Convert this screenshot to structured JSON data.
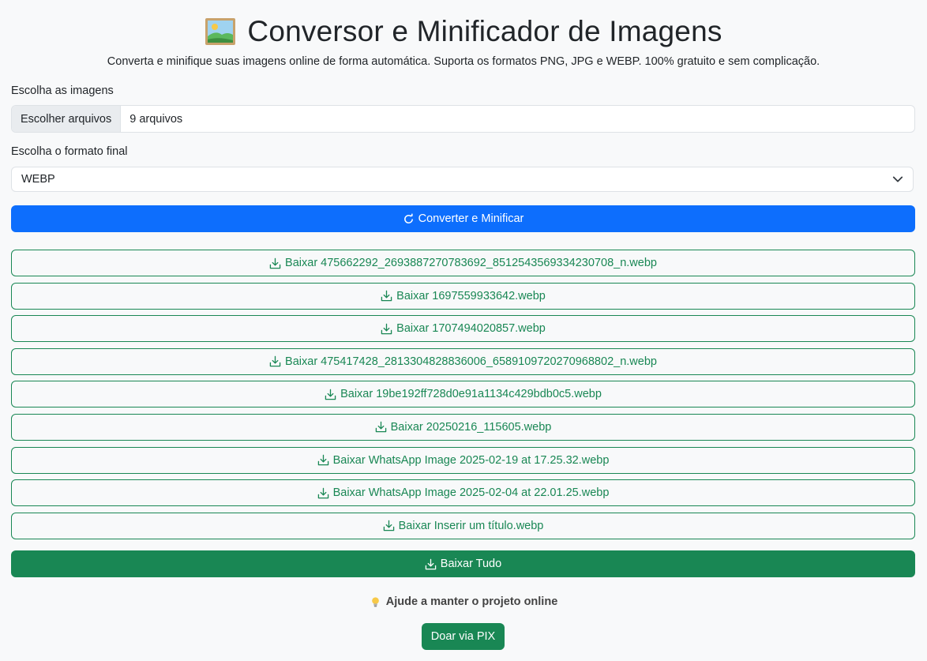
{
  "header": {
    "title": "Conversor e Minificador de Imagens",
    "subtitle": "Converta e minifique suas imagens online de forma automática. Suporta os formatos PNG, JPG e WEBP. 100% gratuito e sem complicação."
  },
  "file_input": {
    "label": "Escolha as imagens",
    "button_label": "Escolher arquivos",
    "value": "9 arquivos"
  },
  "format_select": {
    "label": "Escolha o formato final",
    "selected": "WEBP"
  },
  "convert_button": {
    "label": "Converter e Minificar"
  },
  "downloads": [
    {
      "label": "Baixar 475662292_2693887270783692_8512543569334230708_n.webp"
    },
    {
      "label": "Baixar 1697559933642.webp"
    },
    {
      "label": "Baixar 1707494020857.webp"
    },
    {
      "label": "Baixar 475417428_2813304828836006_6589109720270968802_n.webp"
    },
    {
      "label": "Baixar 19be192ff728d0e91a1134c429bdb0c5.webp"
    },
    {
      "label": "Baixar 20250216_115605.webp"
    },
    {
      "label": "Baixar WhatsApp Image 2025-02-19 at 17.25.32.webp"
    },
    {
      "label": "Baixar WhatsApp Image 2025-02-04 at 22.01.25.webp"
    },
    {
      "label": "Baixar Inserir um título.webp"
    }
  ],
  "download_all": {
    "label": "Baixar Tudo"
  },
  "donate": {
    "text": "Ajude a manter o projeto online",
    "button_label": "Doar via PIX"
  },
  "icons": {
    "title": "picture-icon",
    "convert": "refresh-icon",
    "download": "download-icon",
    "donate": "lightbulb-icon",
    "select": "chevron-down-icon"
  },
  "colors": {
    "primary": "#0d6efd",
    "success": "#198754",
    "background": "#f8f9fa"
  }
}
